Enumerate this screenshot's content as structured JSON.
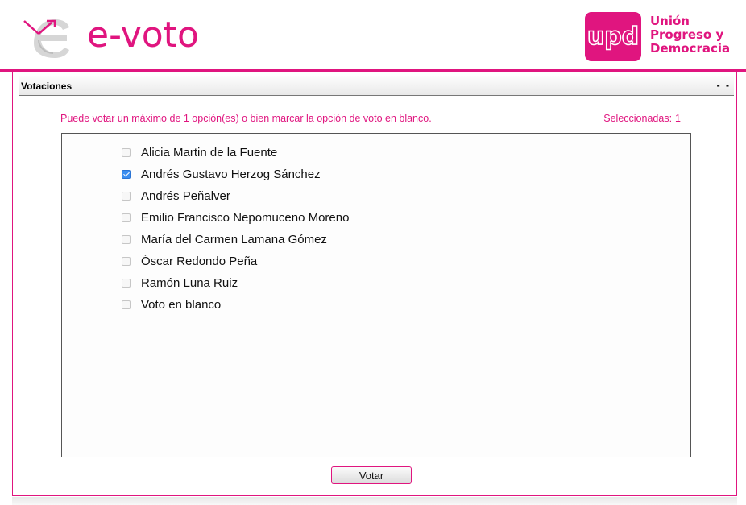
{
  "header": {
    "app_name": "e-voto",
    "brand_logo_text": "upd",
    "party_name_lines": [
      "Unión",
      "Progreso y",
      "Democracia"
    ],
    "accent_color": "#e0157f"
  },
  "panel": {
    "title": "Votaciones",
    "window_control": "- -",
    "instruction": "Puede votar un máximo de 1 opción(es) o bien marcar la opción de voto en blanco.",
    "selected_label": "Seleccionadas:",
    "selected_count": "1",
    "options": [
      {
        "label": "Alicia Martin de la Fuente",
        "checked": false
      },
      {
        "label": "Andrés Gustavo Herzog Sánchez",
        "checked": true
      },
      {
        "label": "Andrés Peñalver",
        "checked": false
      },
      {
        "label": "Emilio Francisco Nepomuceno Moreno",
        "checked": false
      },
      {
        "label": "María del Carmen Lamana Gómez",
        "checked": false
      },
      {
        "label": "Óscar Redondo Peña",
        "checked": false
      },
      {
        "label": "Ramón Luna Ruiz",
        "checked": false
      },
      {
        "label": "Voto en blanco",
        "checked": false
      }
    ],
    "submit_label": "Votar"
  }
}
